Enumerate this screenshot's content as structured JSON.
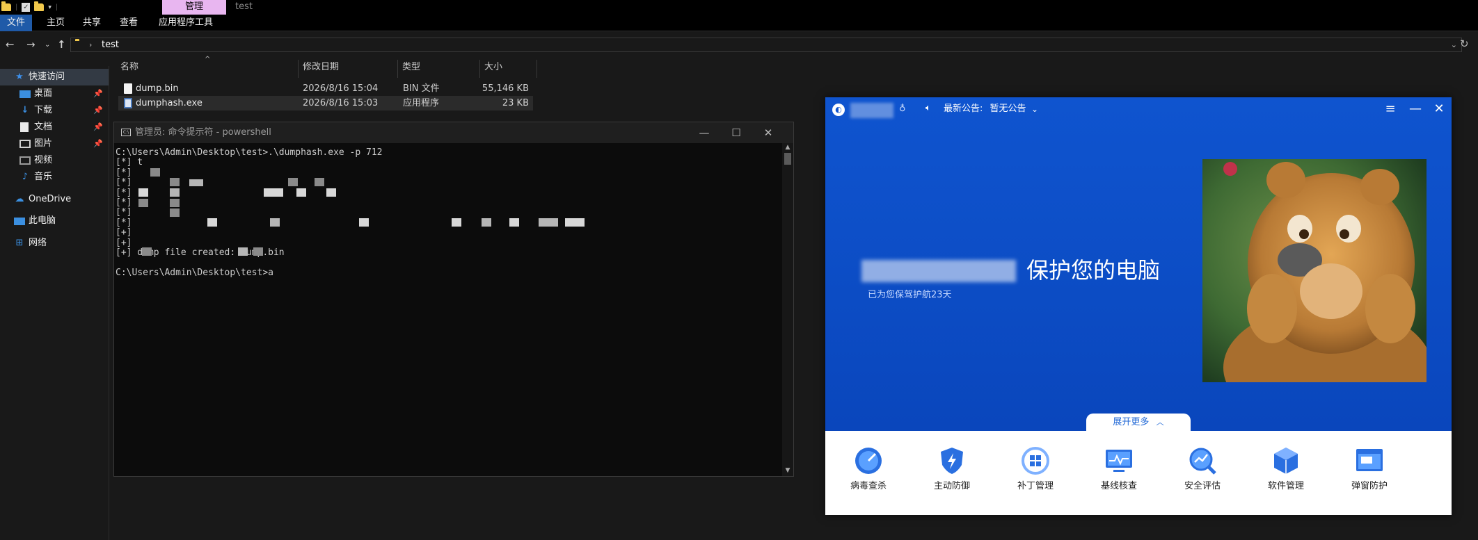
{
  "explorer": {
    "ribbon_context_tab": "管理",
    "window_title": "test",
    "ribbon_tabs": [
      "文件",
      "主页",
      "共享",
      "查看",
      "应用程序工具"
    ],
    "address_path": "test",
    "sidebar": [
      {
        "label": "快速访问",
        "icon": "star-icon",
        "pinned": false
      },
      {
        "label": "桌面",
        "icon": "desktop-icon",
        "pinned": true
      },
      {
        "label": "下载",
        "icon": "download-icon",
        "pinned": true
      },
      {
        "label": "文档",
        "icon": "document-icon",
        "pinned": true
      },
      {
        "label": "图片",
        "icon": "picture-icon",
        "pinned": true
      },
      {
        "label": "视频",
        "icon": "video-icon",
        "pinned": false
      },
      {
        "label": "音乐",
        "icon": "music-icon",
        "pinned": false
      },
      {
        "label": "OneDrive",
        "icon": "cloud-icon",
        "pinned": false
      },
      {
        "label": "此电脑",
        "icon": "computer-icon",
        "pinned": false
      },
      {
        "label": "网络",
        "icon": "network-icon",
        "pinned": false
      }
    ],
    "columns": [
      "名称",
      "修改日期",
      "类型",
      "大小"
    ],
    "files": [
      {
        "name": "dump.bin",
        "modified": "2026/8/16 15:04",
        "type": "BIN 文件",
        "size": "55,146 KB"
      },
      {
        "name": "dumphash.exe",
        "modified": "2026/8/16 15:03",
        "type": "应用程序",
        "size": "23 KB"
      }
    ]
  },
  "powershell": {
    "title": "管理员: 命令提示符 - powershell",
    "lines": [
      "C:\\Users\\Admin\\Desktop\\test>.\\dumphash.exe -p 712",
      "[*] t",
      "[*] ",
      "[*] ",
      "[*] ",
      "[*] ",
      "[*] ",
      "[*] ",
      "[+]",
      "[+] ",
      "[+] dump file created: dump.bin",
      "",
      "C:\\Users\\Admin\\Desktop\\test>a"
    ]
  },
  "antivirus": {
    "notice_label": "最新公告:",
    "notice_value": "暂无公告",
    "headline": "保护您的电脑",
    "subtitle": "已为您保驾护航23天",
    "expand_label": "展开更多",
    "tools": [
      {
        "label": "病毒查杀",
        "icon": "virus-scan-icon"
      },
      {
        "label": "主动防御",
        "icon": "shield-bolt-icon"
      },
      {
        "label": "补丁管理",
        "icon": "patch-icon"
      },
      {
        "label": "基线核查",
        "icon": "monitor-icon"
      },
      {
        "label": "安全评估",
        "icon": "assessment-icon"
      },
      {
        "label": "软件管理",
        "icon": "package-icon"
      },
      {
        "label": "弹窗防护",
        "icon": "popup-block-icon"
      }
    ],
    "colors": {
      "brand_blue": "#0f54cf",
      "accent": "#1f67d6"
    }
  }
}
